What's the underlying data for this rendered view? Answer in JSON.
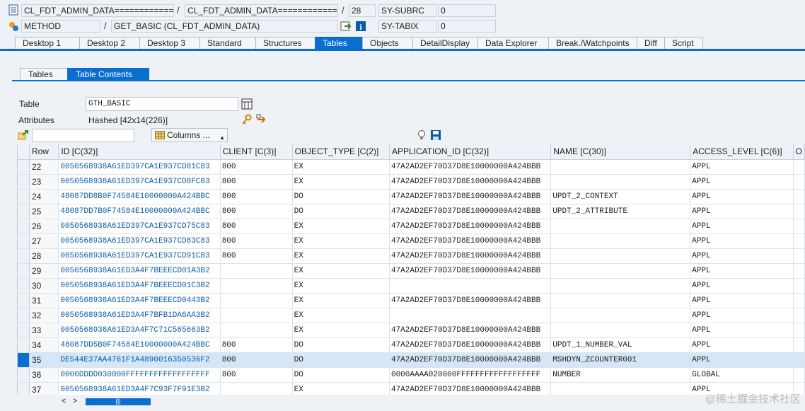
{
  "header": {
    "row1": {
      "program_a": "CL_FDT_ADMIN_DATA============...",
      "program_b": "CL_FDT_ADMIN_DATA============...",
      "line": "28",
      "var_name": "SY-SUBRC",
      "var_value": "0"
    },
    "row2": {
      "event_type": "METHOD",
      "event": "GET_BASIC (CL_FDT_ADMIN_DATA)",
      "var_name": "SY-TABIX",
      "var_value": "0"
    }
  },
  "main_tabs": [
    "Desktop 1",
    "Desktop 2",
    "Desktop 3",
    "Standard",
    "Structures",
    "Tables",
    "Objects",
    "DetailDisplay",
    "Data Explorer",
    "Break./Watchpoints",
    "Diff",
    "Script"
  ],
  "sub_tabs": [
    "Tables",
    "Table Contents"
  ],
  "table_field": {
    "label": "Table",
    "value": "GTH_BASIC"
  },
  "attributes": {
    "label": "Attributes",
    "value": "Hashed [42x14(226)]"
  },
  "columns_button": "Columns ...",
  "grid": {
    "columns": [
      "Row",
      "ID [C(32)]",
      "CLIENT [C(3)]",
      "OBJECT_TYPE [C(2)]",
      "APPLICATION_ID [C(32)]",
      "NAME [C(30)]",
      "ACCESS_LEVEL [C(6)]",
      "O"
    ],
    "rows": [
      {
        "row": "22",
        "id": "0050568938A61ED397CA1E937CD81C83",
        "client": "800",
        "type": "EX",
        "app": "47A2AD2EF70D37D8E10000000A424BBB",
        "name": "",
        "level": "APPL"
      },
      {
        "row": "23",
        "id": "0050568938A61ED397CA1E937CD8FC83",
        "client": "800",
        "type": "EX",
        "app": "47A2AD2EF70D37D8E10000000A424BBB",
        "name": "",
        "level": "APPL"
      },
      {
        "row": "24",
        "id": "48087DD8B0F74584E10000000A424BBC",
        "client": "800",
        "type": "DO",
        "app": "47A2AD2EF70D37D8E10000000A424BBB",
        "name": "UPDT_2_CONTEXT",
        "level": "APPL"
      },
      {
        "row": "25",
        "id": "48087DD7B0F74584E10000000A424BBC",
        "client": "800",
        "type": "DO",
        "app": "47A2AD2EF70D37D8E10000000A424BBB",
        "name": "UPDT_2_ATTRIBUTE",
        "level": "APPL"
      },
      {
        "row": "26",
        "id": "0050568938A61ED397CA1E937CD75C83",
        "client": "800",
        "type": "EX",
        "app": "47A2AD2EF70D37D8E10000000A424BBB",
        "name": "",
        "level": "APPL"
      },
      {
        "row": "27",
        "id": "0050568938A61ED397CA1E937CD83C83",
        "client": "800",
        "type": "EX",
        "app": "47A2AD2EF70D37D8E10000000A424BBB",
        "name": "",
        "level": "APPL"
      },
      {
        "row": "28",
        "id": "0050568938A61ED397CA1E937CD91C83",
        "client": "800",
        "type": "EX",
        "app": "47A2AD2EF70D37D8E10000000A424BBB",
        "name": "",
        "level": "APPL"
      },
      {
        "row": "29",
        "id": "0050568938A61ED3A4F7BEEECD01A3B2",
        "client": "",
        "type": "EX",
        "app": "47A2AD2EF70D37D8E10000000A424BBB",
        "name": "",
        "level": "APPL"
      },
      {
        "row": "30",
        "id": "0050568938A61ED3A4F7BEEECD01C3B2",
        "client": "",
        "type": "EX",
        "app": "",
        "name": "",
        "level": "APPL"
      },
      {
        "row": "31",
        "id": "0050568938A61ED3A4F7BEEECD0443B2",
        "client": "",
        "type": "EX",
        "app": "47A2AD2EF70D37D8E10000000A424BBB",
        "name": "",
        "level": "APPL"
      },
      {
        "row": "32",
        "id": "0050568938A61ED3A4F7BFB1DA6AA3B2",
        "client": "",
        "type": "EX",
        "app": "",
        "name": "",
        "level": "APPL"
      },
      {
        "row": "33",
        "id": "0050568938A61ED3A4F7C71C565663B2",
        "client": "",
        "type": "EX",
        "app": "47A2AD2EF70D37D8E10000000A424BBB",
        "name": "",
        "level": "APPL"
      },
      {
        "row": "34",
        "id": "48087DD5B0F74584E10000000A424BBC",
        "client": "800",
        "type": "DO",
        "app": "47A2AD2EF70D37D8E10000000A424BBB",
        "name": "UPDT_1_NUMBER_VAL",
        "level": "APPL"
      },
      {
        "row": "35",
        "id": "DE544E37AA4761F1A4890016350536F2",
        "client": "800",
        "type": "DO",
        "app": "47A2AD2EF70D37D8E10000000A424BBB",
        "name": "MSHDYN_ZCOUNTER001",
        "level": "APPL"
      },
      {
        "row": "36",
        "id": "0000DDDD030000FFFFFFFFFFFFFFFFFF",
        "client": "800",
        "type": "DO",
        "app": "0000AAAA020000FFFFFFFFFFFFFFFFFF",
        "name": "NUMBER",
        "level": "GLOBAL"
      },
      {
        "row": "37",
        "id": "0050568938A61ED3A4F7C93F7F91E3B2",
        "client": "",
        "type": "EX",
        "app": "47A2AD2EF70D37D8E10000000A424BBB",
        "name": "",
        "level": "APPL"
      }
    ],
    "highlight_row": "35"
  },
  "scroll_thumb": "|||",
  "watermark": "@稀土掘金技术社区"
}
